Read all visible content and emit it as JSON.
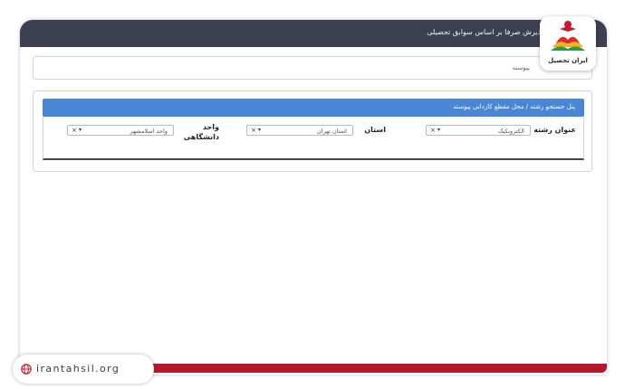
{
  "header": {
    "title": "پذیرش صرفا بر اساس سوابق تحصیلی"
  },
  "breadcrumb": {
    "text": "پیوسته"
  },
  "search_panel": {
    "title": "پنل جستجو رشته / محل مقطع کاردانی پیوسته",
    "fields": [
      {
        "label": "عنوان رشته",
        "value": "الکترونکیک"
      },
      {
        "label": "استان",
        "value": "استان تهران"
      },
      {
        "label": "واحد دانشگاهی",
        "value": "واحد اسلامشهر"
      }
    ],
    "clear_symbol": "×",
    "caret_symbol": "▾"
  },
  "logo": {
    "name": "ایران تحصیل"
  },
  "footer": {
    "site_url": "irantahsil.org"
  },
  "colors": {
    "topbar": "#3b4150",
    "panel_header": "#4a86d6",
    "accent_red": "#b5182a"
  }
}
